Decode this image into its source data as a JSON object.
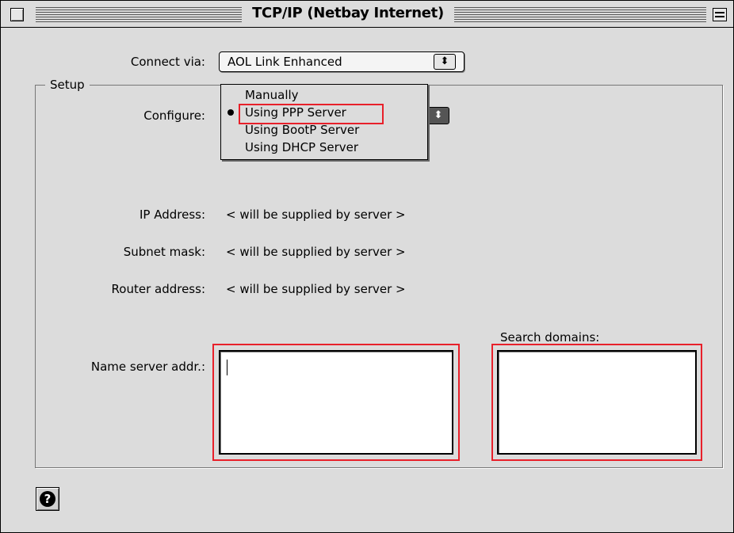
{
  "window": {
    "title": "TCP/IP (Netbay Internet)"
  },
  "connect_via": {
    "label": "Connect via:",
    "value": "AOL Link Enhanced"
  },
  "setup": {
    "group_title": "Setup",
    "configure_label": "Configure:",
    "menu_items": [
      {
        "label": "Manually",
        "selected": false
      },
      {
        "label": "Using PPP Server",
        "selected": true
      },
      {
        "label": "Using BootP Server",
        "selected": false
      },
      {
        "label": "Using DHCP Server",
        "selected": false
      }
    ],
    "ip_address_label": "IP Address:",
    "ip_address_value": "< will be supplied by server >",
    "subnet_mask_label": "Subnet mask:",
    "subnet_mask_value": "< will be supplied by server >",
    "router_address_label": "Router address:",
    "router_address_value": "< will be supplied by server >",
    "name_server_label": "Name server addr.:",
    "name_server_value": "",
    "search_domains_label": "Search domains:",
    "search_domains_value": ""
  },
  "help_button": {
    "icon": "help-icon",
    "glyph": "?"
  },
  "colors": {
    "highlight": "#e8202a"
  }
}
